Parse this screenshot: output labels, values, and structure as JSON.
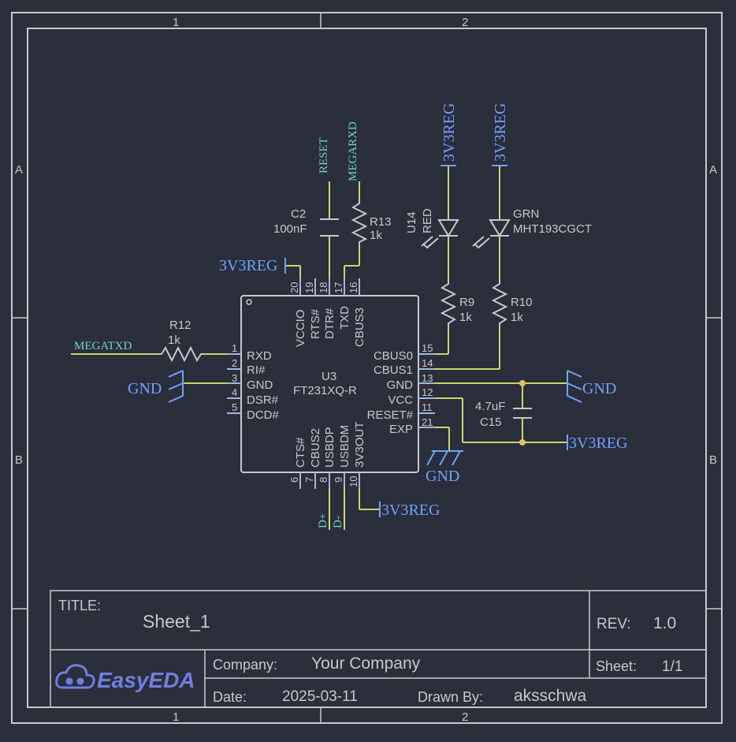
{
  "frame": {
    "zones_top": [
      "1",
      "2"
    ],
    "zones_bottom": [
      "1",
      "2"
    ],
    "zones_left": [
      "A",
      "B"
    ],
    "zones_right": [
      "A",
      "B"
    ]
  },
  "title_block": {
    "title_label": "TITLE:",
    "title_value": "Sheet_1",
    "rev_label": "REV:",
    "rev_value": "1.0",
    "company_label": "Company:",
    "company_value": "Your Company",
    "sheet_label": "Sheet:",
    "sheet_value": "1/1",
    "date_label": "Date:",
    "date_value": "2025-03-11",
    "drawn_label": "Drawn By:",
    "drawn_value": "aksschwa",
    "logo_text": "EasyEDA"
  },
  "u3": {
    "designator": "U3",
    "value": "FT231XQ-R",
    "left_pins": [
      {
        "num": "1",
        "name": "RXD"
      },
      {
        "num": "2",
        "name": "RI#"
      },
      {
        "num": "3",
        "name": "GND"
      },
      {
        "num": "4",
        "name": "DSR#"
      },
      {
        "num": "5",
        "name": "DCD#"
      }
    ],
    "right_pins": [
      {
        "num": "15",
        "name": "CBUS0"
      },
      {
        "num": "14",
        "name": "CBUS1"
      },
      {
        "num": "13",
        "name": "GND"
      },
      {
        "num": "12",
        "name": "VCC"
      },
      {
        "num": "11",
        "name": "RESET#"
      },
      {
        "num": "21",
        "name": "EXP"
      }
    ],
    "top_pins": [
      {
        "num": "20",
        "name": "VCCIO"
      },
      {
        "num": "19",
        "name": "RTS#"
      },
      {
        "num": "18",
        "name": "DTR#"
      },
      {
        "num": "17",
        "name": "TXD"
      },
      {
        "num": "16",
        "name": "CBUS3"
      }
    ],
    "bottom_pins": [
      {
        "num": "6",
        "name": "CTS#"
      },
      {
        "num": "7",
        "name": "CBUS2"
      },
      {
        "num": "8",
        "name": "USBDP"
      },
      {
        "num": "9",
        "name": "USBDM"
      },
      {
        "num": "10",
        "name": "3V3OUT"
      }
    ]
  },
  "components": {
    "r12": {
      "ref": "R12",
      "value": "1k"
    },
    "r13": {
      "ref": "R13",
      "value": "1k"
    },
    "r9": {
      "ref": "R9",
      "value": "1k"
    },
    "r10": {
      "ref": "R10",
      "value": "1k"
    },
    "c2": {
      "ref": "C2",
      "value": "100nF"
    },
    "c15": {
      "ref": "C15",
      "value": "4.7uF"
    },
    "u14": {
      "ref": "U14",
      "value": "RED"
    },
    "led_grn": {
      "ref": "GRN",
      "value": "MHT193CGCT"
    }
  },
  "nets": {
    "reset": "RESET",
    "megarxd": "MEGARXD",
    "megatxd": "MEGATXD",
    "dplus": "D+",
    "dminus": "D-",
    "pwr": "3V3REG",
    "gnd": "GND"
  },
  "colors": {
    "background": "#2b2e3b",
    "frame": "#c8c8cc",
    "pin": "#a0b8e0",
    "wire": "#c7d76d",
    "power_net": "#6fa3ff",
    "net_label": "#6fd3d6",
    "junction": "#e8c060",
    "logo": "#6f7fe0"
  }
}
